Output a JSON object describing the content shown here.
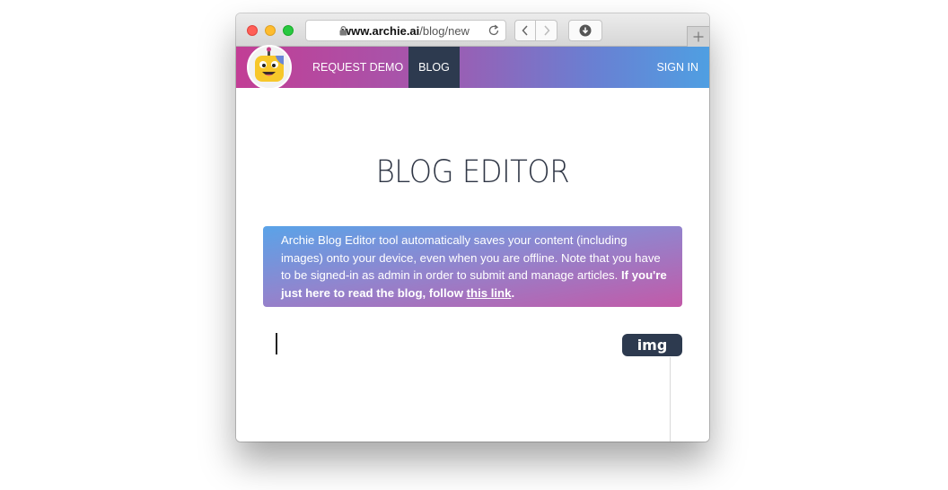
{
  "browser": {
    "url_domain": "www.archie.ai",
    "url_path": "/blog/new",
    "icons": {
      "lock": "lock-icon",
      "reload": "reload-icon",
      "back": "chevron-left-icon",
      "forward": "chevron-right-icon",
      "download": "download-icon",
      "new_tab": "plus-icon"
    }
  },
  "nav": {
    "logo": "archie-robot-logo",
    "request_demo": "REQUEST DEMO",
    "blog": "BLOG",
    "sign_in": "SIGN IN"
  },
  "page": {
    "title": "BLOG EDITOR",
    "notice_text": "Archie Blog Editor tool automatically saves your content (including images) onto your device, even when you are offline. Note that you have to be signed-in as admin in order to submit and manage articles.",
    "notice_bold_prefix": "If you're just here to read the blog, follow ",
    "notice_link": "this link",
    "notice_bold_suffix": ".",
    "img_button": "img"
  },
  "colors": {
    "nav_gradient_start": "#c23e95",
    "nav_gradient_end": "#4f9fe2",
    "active_tab": "#2d3a4f",
    "title_text": "#2f3645",
    "img_button_bg": "#2d3a4f"
  }
}
